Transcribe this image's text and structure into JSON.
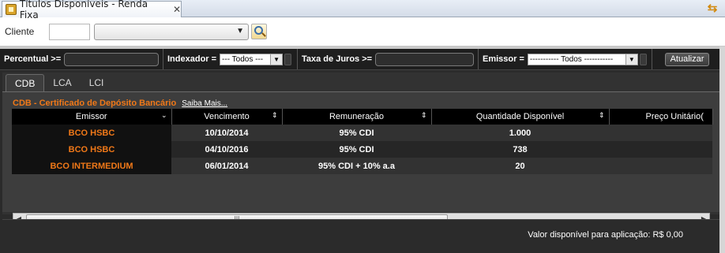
{
  "window": {
    "title": "Títulos Disponíveis - Renda Fixa",
    "close_glyph": "✕"
  },
  "client": {
    "label": "Cliente",
    "code_value": "",
    "select_value": ""
  },
  "filters": {
    "percentual_label": "Percentual >=",
    "percentual_value": "",
    "indexador_label": "Indexador =",
    "indexador_value": "--- Todos ---",
    "taxa_label": "Taxa de Juros >=",
    "taxa_value": "",
    "emissor_label": "Emissor =",
    "emissor_value": "----------- Todos -----------",
    "refresh_label": "Atualizar"
  },
  "tabs": [
    {
      "label": "CDB",
      "active": true
    },
    {
      "label": "LCA",
      "active": false
    },
    {
      "label": "LCI",
      "active": false
    }
  ],
  "section": {
    "title": "CDB - Certificado de Depósito Bancário",
    "link": "Saiba Mais..."
  },
  "table": {
    "columns": [
      "Emissor",
      "Vencimento",
      "Remuneração",
      "Quantidade Disponível",
      "Preço Unitário("
    ],
    "rows": [
      [
        "BCO HSBC",
        "10/10/2014",
        "95% CDI",
        "1.000",
        ""
      ],
      [
        "BCO HSBC",
        "04/10/2016",
        "95% CDI",
        "738",
        ""
      ],
      [
        "BCO INTERMEDIUM",
        "06/01/2014",
        "95% CDI + 10% a.a",
        "20",
        ""
      ]
    ]
  },
  "scrollbar": {
    "grip": "III"
  },
  "footer": {
    "available_text": "Valor disponível para aplicação: R$ 0,00"
  },
  "colors": {
    "accent_orange": "#f07818",
    "background": "#2b2b2b"
  }
}
